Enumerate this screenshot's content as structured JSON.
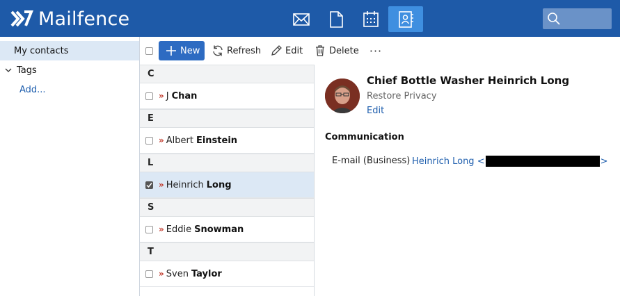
{
  "app": {
    "name": "Mailfence",
    "colors": {
      "header": "#1e5aa8",
      "active_nav": "#3f8fe0",
      "link": "#1f5fae",
      "selected": "#dce8f5",
      "new_button": "#2d6bc2"
    }
  },
  "nav": [
    {
      "icon": "mail-icon"
    },
    {
      "icon": "document-icon"
    },
    {
      "icon": "calendar-icon"
    },
    {
      "icon": "contacts-icon",
      "active": true
    }
  ],
  "search": {
    "placeholder": "",
    "value": "",
    "icon": "search-icon"
  },
  "sidebar": {
    "my_contacts": "My contacts",
    "tags": "Tags",
    "add": "Add..."
  },
  "toolbar": {
    "new": "New",
    "refresh": "Refresh",
    "edit": "Edit",
    "delete": "Delete",
    "more": "···"
  },
  "contact_groups": [
    {
      "letter": "C",
      "contacts": [
        {
          "first": "J",
          "last": "Chan",
          "checked": false
        }
      ]
    },
    {
      "letter": "E",
      "contacts": [
        {
          "first": "Albert",
          "last": "Einstein",
          "checked": false
        }
      ]
    },
    {
      "letter": "L",
      "contacts": [
        {
          "first": "Heinrich",
          "last": "Long",
          "checked": true,
          "selected": true
        }
      ]
    },
    {
      "letter": "S",
      "contacts": [
        {
          "first": "Eddie",
          "last": "Snowman",
          "checked": false
        }
      ]
    },
    {
      "letter": "T",
      "contacts": [
        {
          "first": "Sven",
          "last": "Taylor",
          "checked": false
        }
      ]
    }
  ],
  "detail": {
    "name": "Chief Bottle Washer Heinrich Long",
    "organization": "Restore Privacy",
    "edit": "Edit",
    "section": "Communication",
    "email_label": "E-mail (Business)",
    "email_prefix": "Heinrich Long <",
    "email_suffix": ">"
  }
}
